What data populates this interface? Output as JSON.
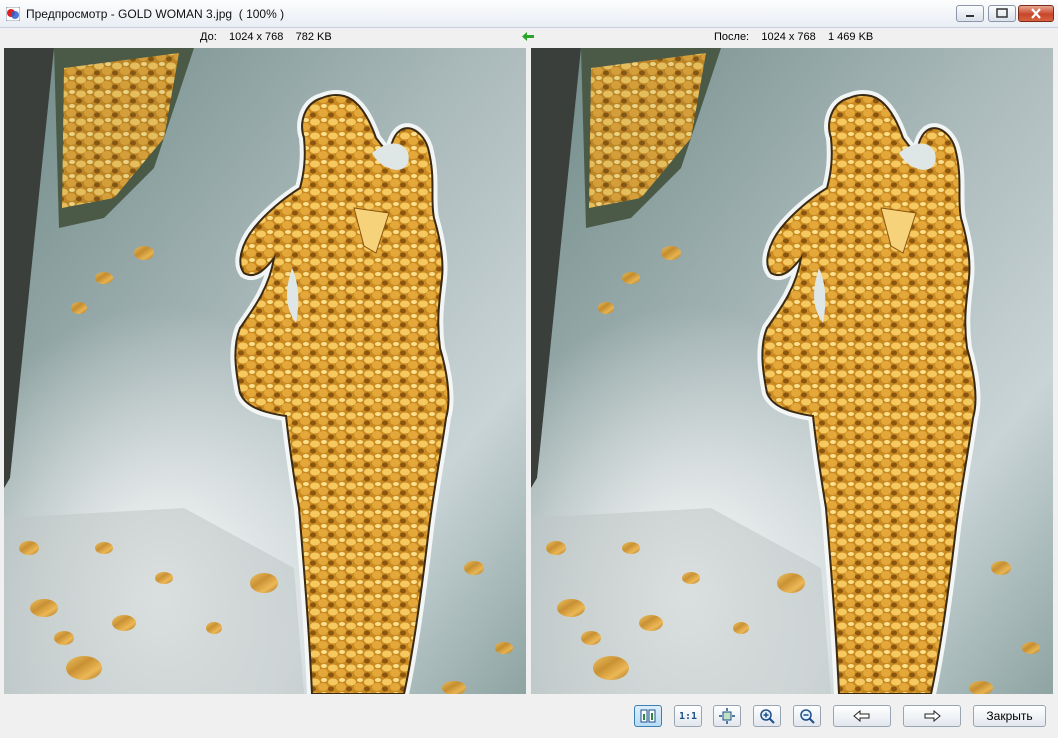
{
  "window": {
    "title": "Предпросмотр - GOLD WOMAN 3.jpg  ( 100% )"
  },
  "info": {
    "before": "До:    1024 x 768    782 KB",
    "after": "После:    1024 x 768    1 469 KB",
    "swap_icon": "green-left-arrow-icon"
  },
  "toolbar": {
    "compare_icon": "side-by-side-compare-icon",
    "actual_size_label": "1:1",
    "fit_icon": "fit-to-window-icon",
    "zoom_in_icon": "zoom-in-icon",
    "zoom_out_icon": "zoom-out-icon",
    "prev_icon": "arrow-left-icon",
    "next_icon": "arrow-right-icon",
    "close_label": "Закрыть"
  },
  "colors": {
    "accent": "#3c7fb1",
    "arrow_green": "#2aa52a",
    "close_red": "#c8462a"
  }
}
